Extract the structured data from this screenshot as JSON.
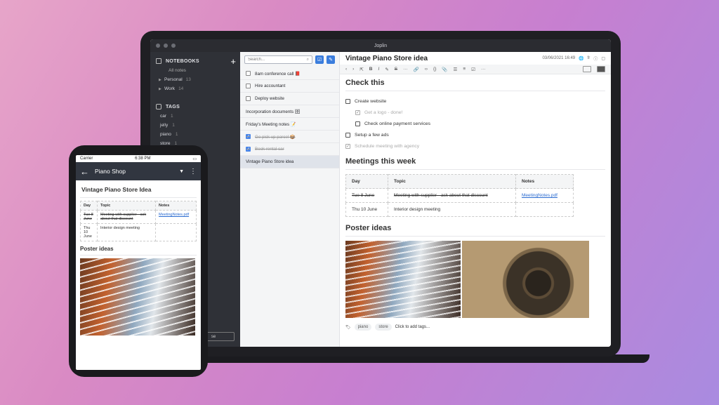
{
  "window": {
    "title": "Joplin"
  },
  "sidebar": {
    "notebooks_label": "NOTEBOOKS",
    "all_notes": "All notes",
    "notebooks": [
      {
        "name": "Personal",
        "count": "13"
      },
      {
        "name": "Work",
        "count": "14"
      }
    ],
    "tags_label": "TAGS",
    "tags": [
      {
        "name": "car",
        "count": "1"
      },
      {
        "name": "jelly",
        "count": "1"
      },
      {
        "name": "piano",
        "count": "1"
      },
      {
        "name": "store",
        "count": "1"
      }
    ],
    "sync_label": "se"
  },
  "notelist": {
    "search_placeholder": "Search...",
    "notes": [
      {
        "title": "8am conference call 📕",
        "todo": true,
        "done": false
      },
      {
        "title": "Hire accountant",
        "todo": true,
        "done": false
      },
      {
        "title": "Deploy website",
        "todo": true,
        "done": false
      },
      {
        "title": "Incorporation documents 🗄",
        "todo": false,
        "done": false
      },
      {
        "title": "Friday's Meeting notes 📝",
        "todo": false,
        "done": false
      },
      {
        "title": "Go pick up parcel 📦",
        "todo": true,
        "done": true
      },
      {
        "title": "Book rental car",
        "todo": true,
        "done": true
      },
      {
        "title": "Vintage Piano Store idea",
        "todo": false,
        "done": false,
        "selected": true
      }
    ]
  },
  "editor": {
    "title": "Vintage Piano Store idea",
    "date": "03/06/2021 16:49",
    "lang": "fr",
    "section1": "Check this",
    "checklist": [
      {
        "text": "Create website",
        "done": false,
        "indent": false
      },
      {
        "text": "Get a logo - done!",
        "done": true,
        "indent": true
      },
      {
        "text": "Check online payment services",
        "done": false,
        "indent": true
      },
      {
        "text": "Setup a few ads",
        "done": false,
        "indent": false
      },
      {
        "text": "Schedule meeting with agency",
        "done": true,
        "indent": false
      }
    ],
    "section2": "Meetings this week",
    "table": {
      "headers": [
        "Day",
        "Topic",
        "Notes"
      ],
      "rows": [
        {
          "day": "Tue 8 June",
          "topic": "Meeting with supplier - ask about that discount",
          "notes": "MeetingNotes.pdf",
          "struck": true
        },
        {
          "day": "Thu 10 June",
          "topic": "Interior design meeting",
          "notes": "",
          "struck": false
        }
      ]
    },
    "section3": "Poster ideas",
    "tags": [
      "piano",
      "store"
    ],
    "add_tags": "Click to add tags..."
  },
  "phone": {
    "carrier": "Carrier",
    "time": "6:38 PM",
    "notebook": "Piano Shop",
    "title": "Vintage Piano Store Idea",
    "table": {
      "headers": [
        "Day",
        "Topic",
        "Notes"
      ],
      "rows": [
        {
          "day": "Tue 8 June",
          "topic": "Meeting with supplier - ask about that discount",
          "notes": "MeetingNotes.pdf"
        },
        {
          "day": "Thu 10 June",
          "topic": "Interior design meeting",
          "notes": ""
        }
      ]
    },
    "section": "Poster ideas"
  }
}
